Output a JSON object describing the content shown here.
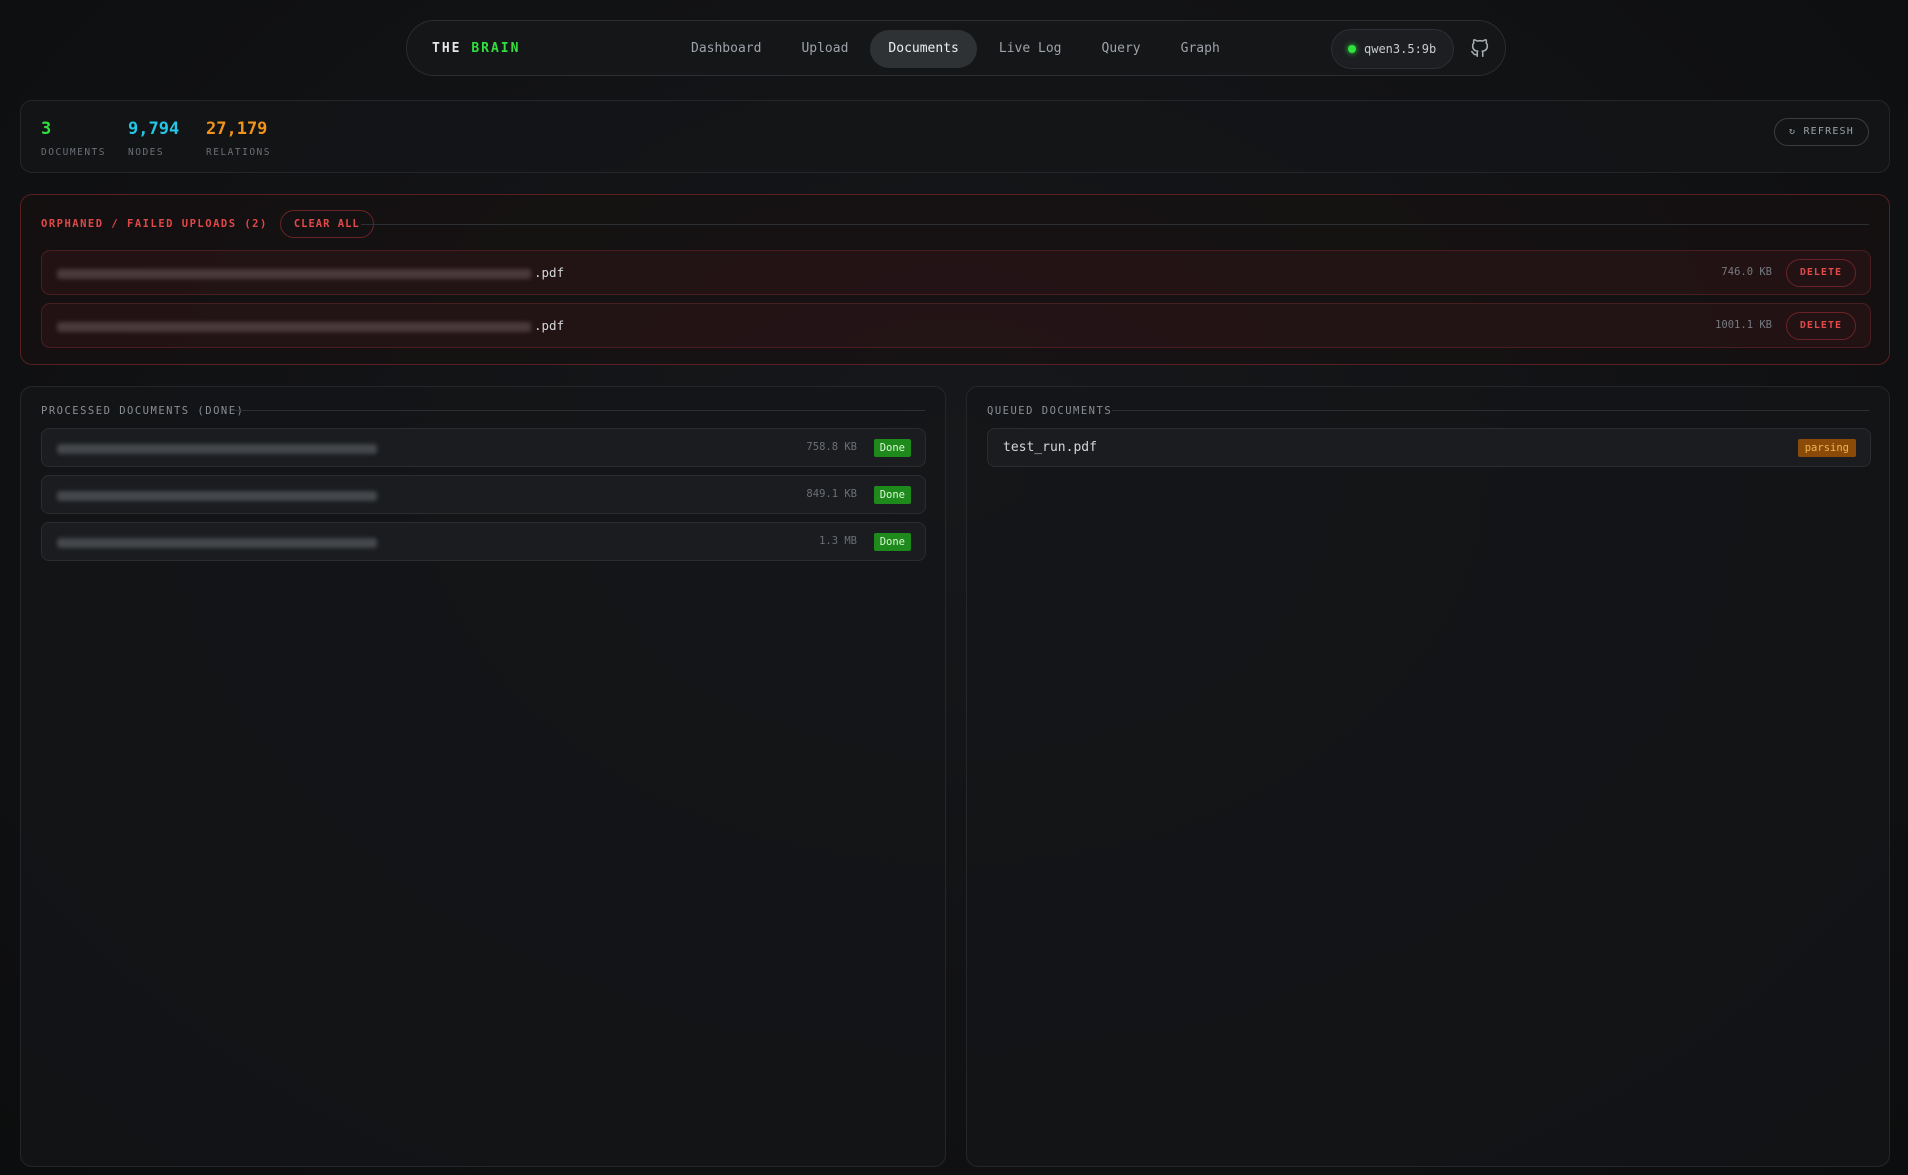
{
  "nav": {
    "brand_prefix": "THE",
    "brand_accent": "BRAIN",
    "links": [
      {
        "label": "Dashboard",
        "active": false
      },
      {
        "label": "Upload",
        "active": false
      },
      {
        "label": "Documents",
        "active": true
      },
      {
        "label": "Live Log",
        "active": false
      },
      {
        "label": "Query",
        "active": false
      },
      {
        "label": "Graph",
        "active": false
      }
    ],
    "model": "qwen3.5:9b",
    "model_status_color": "#2fe23e",
    "github_icon": "github-icon"
  },
  "stats": {
    "items": [
      {
        "value": "3",
        "label": "DOCUMENTS",
        "color": "#31e03f"
      },
      {
        "value": "9,794",
        "label": "NODES",
        "color": "#22c6e6"
      },
      {
        "value": "27,179",
        "label": "RELATIONS",
        "color": "#f2941a"
      }
    ],
    "refresh_label": "↻ REFRESH"
  },
  "orphaned": {
    "title": "ORPHANED / FAILED UPLOADS (2)",
    "clear_label": "CLEAR ALL",
    "rows": [
      {
        "name_suffix": ".pdf",
        "size": "746.0 KB",
        "delete_label": "DELETE"
      },
      {
        "name_suffix": ".pdf",
        "size": "1001.1 KB",
        "delete_label": "DELETE"
      }
    ]
  },
  "processed": {
    "title": "PROCESSED DOCUMENTS (DONE)",
    "rows": [
      {
        "size": "758.8 KB",
        "status": "Done"
      },
      {
        "size": "849.1 KB",
        "status": "Done"
      },
      {
        "size": "1.3 MB",
        "status": "Done"
      }
    ]
  },
  "queued": {
    "title": "QUEUED DOCUMENTS",
    "rows": [
      {
        "name": "test_run.pdf",
        "status": "parsing"
      }
    ]
  },
  "colors": {
    "accent_green": "#31e03f",
    "nodes_cyan": "#22c6e6",
    "relations_orange": "#f2941a",
    "danger_red": "#e24a4a"
  }
}
